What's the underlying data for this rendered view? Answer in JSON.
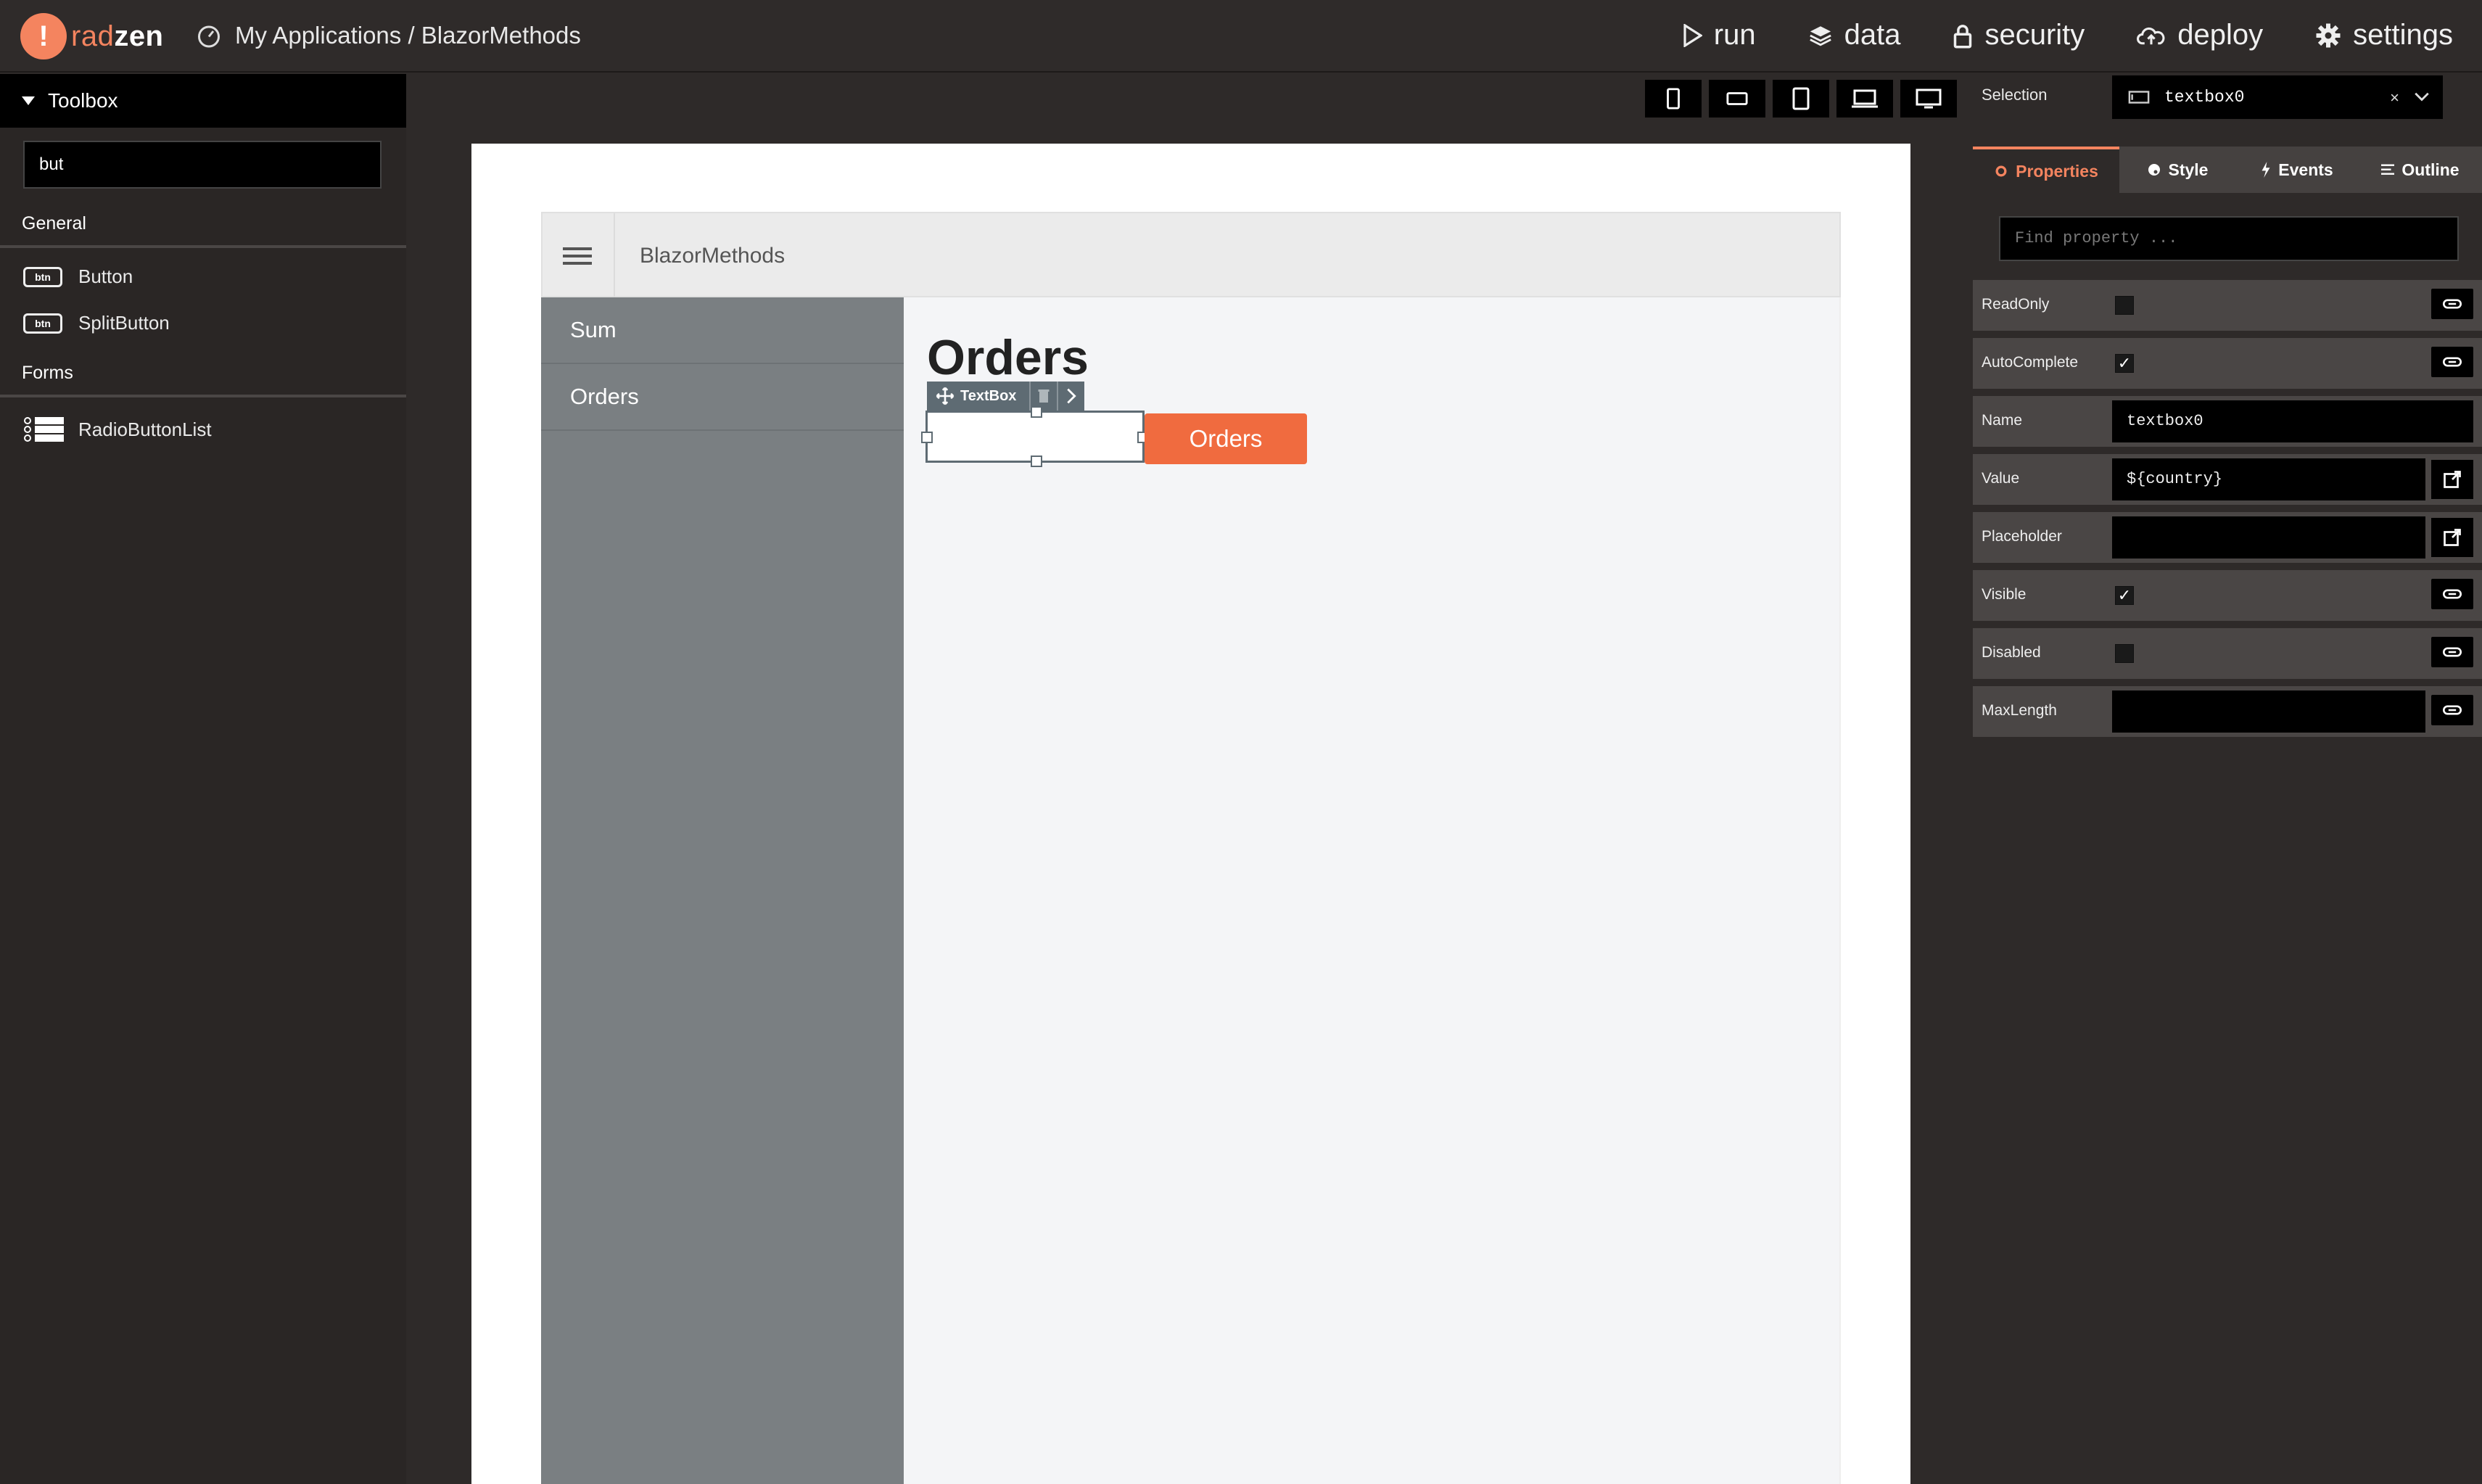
{
  "app": {
    "logo_mark": "!",
    "logo_rad": "rad",
    "logo_zen": "zen",
    "breadcrumb": "My Applications / BlazorMethods"
  },
  "topnav": {
    "run": "run",
    "data": "data",
    "security": "security",
    "deploy": "deploy",
    "settings": "settings"
  },
  "toolbox": {
    "title": "Toolbox",
    "search_value": "but",
    "groups": [
      {
        "label": "General",
        "items": [
          {
            "icon_text": "btn",
            "label": "Button"
          },
          {
            "icon_text": "btn",
            "label": "SplitButton"
          }
        ]
      },
      {
        "label": "Forms",
        "items": [
          {
            "label": "RadioButtonList"
          }
        ]
      }
    ]
  },
  "canvas": {
    "header_title": "BlazorMethods",
    "sidebar_items": [
      "Sum",
      "Orders"
    ],
    "page_heading": "Orders",
    "selected_component_label": "TextBox",
    "orders_button_label": "Orders"
  },
  "properties_panel": {
    "selection_label": "Selection",
    "selection_value": "textbox0",
    "selection_clear": "×",
    "tabs": [
      "Properties",
      "Style",
      "Events",
      "Outline"
    ],
    "active_tab": "Properties",
    "find_placeholder": "Find property ...",
    "props": [
      {
        "label": "ReadOnly",
        "type": "checkbox",
        "checked": false
      },
      {
        "label": "AutoComplete",
        "type": "checkbox",
        "checked": true
      },
      {
        "label": "Name",
        "type": "text",
        "value": "textbox0"
      },
      {
        "label": "Value",
        "type": "text",
        "value": "${country}"
      },
      {
        "label": "Placeholder",
        "type": "text",
        "value": ""
      },
      {
        "label": "Visible",
        "type": "checkbox",
        "checked": true
      },
      {
        "label": "Disabled",
        "type": "checkbox",
        "checked": false
      },
      {
        "label": "MaxLength",
        "type": "text",
        "value": ""
      }
    ],
    "check_mark": "✓"
  },
  "colors": {
    "accent": "#f4845f",
    "button": "#f06b3f",
    "sidebar": "#7a7f82"
  }
}
